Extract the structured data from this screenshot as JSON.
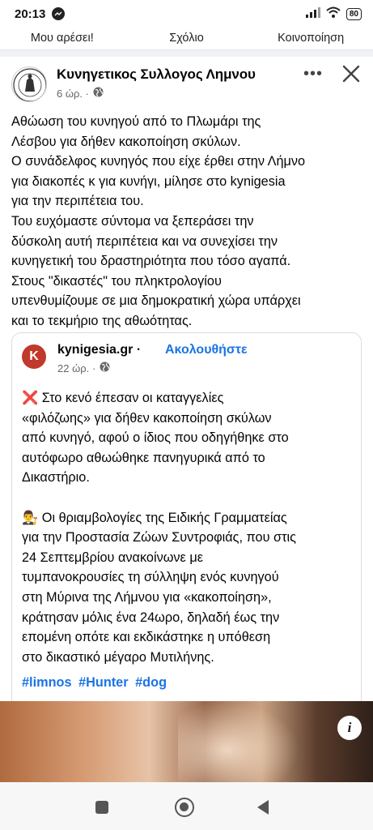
{
  "status": {
    "time": "20:13",
    "battery": "80"
  },
  "actions": {
    "like": "Μου αρέσει!",
    "comment": "Σχόλιο",
    "share": "Κοινοποίηση"
  },
  "post": {
    "author": "Κυνηγετικος Συλλογος Λημνου",
    "time": "6 ώρ. ·",
    "lines": [
      "Αθώωση του κυνηγού από το Πλωμάρι της",
      "Λέσβου για δήθεν κακοποίηση σκύλων.",
      "Ο συνάδελφος κυνηγός που είχε έρθει στην Λήμνο",
      "για διακοπές κ για κυνήγι,  μίλησε  στο kynigesia",
      "για την περιπέτεια του.",
      "Του ευχόμαστε σύντομα να ξεπεράσει την",
      "δύσκολη αυτή περιπέτεια και να συνεχίσει την",
      "κυνηγετική του δραστηριότητα που τόσο αγαπά.",
      "Στους \"δικαστές\" του πληκτρολογίου",
      "υπενθυμίζουμε σε μια δημοκρατική χώρα υπάρχει",
      "και το τεκμήριο της αθωότητας."
    ]
  },
  "shared": {
    "source": "kynigesia.gr",
    "separator": "·",
    "follow": "Ακολουθήστε",
    "time": "22 ώρ. ·",
    "para1": [
      "❌ Στο κενό έπεσαν οι καταγγελίες",
      "«φιλόζωης» για δήθεν κακοποίηση σκύλων",
      "από κυνηγό, αφού ο ίδιος που οδηγήθηκε στο",
      "αυτόφωρο αθωώθηκε πανηγυρικά από το",
      "Δικαστήριο."
    ],
    "para2": [
      "👨‍⚖️ Οι θριαμβολογίες της Ειδικής Γραμματείας",
      "για την Προστασία Ζώων Συντροφιάς, που στις",
      "24 Σεπτεμβρίου ανακοίνωνε με",
      "τυμπανοκρουσίες τη σύλληψη ενός κυνηγού",
      "στη Μύρινα της Λήμνου για «κακοποίηση»,",
      "κράτησαν μόλις ένα 24ωρο, δηλαδή έως την",
      "επομένη οπότε και εκδικάστηκε η υπόθεση",
      "στο δικαστικό μέγαρο Μυτιλήνης."
    ],
    "hashtags": [
      "#limnos",
      "#Hunter",
      "#dog"
    ]
  },
  "icons": {
    "globe": "globe-icon",
    "close": "close-icon",
    "more": "more-icon",
    "info": "info-icon"
  },
  "colors": {
    "link": "#1b74e4",
    "meta": "#65676b",
    "brand_red": "#c0392b"
  }
}
